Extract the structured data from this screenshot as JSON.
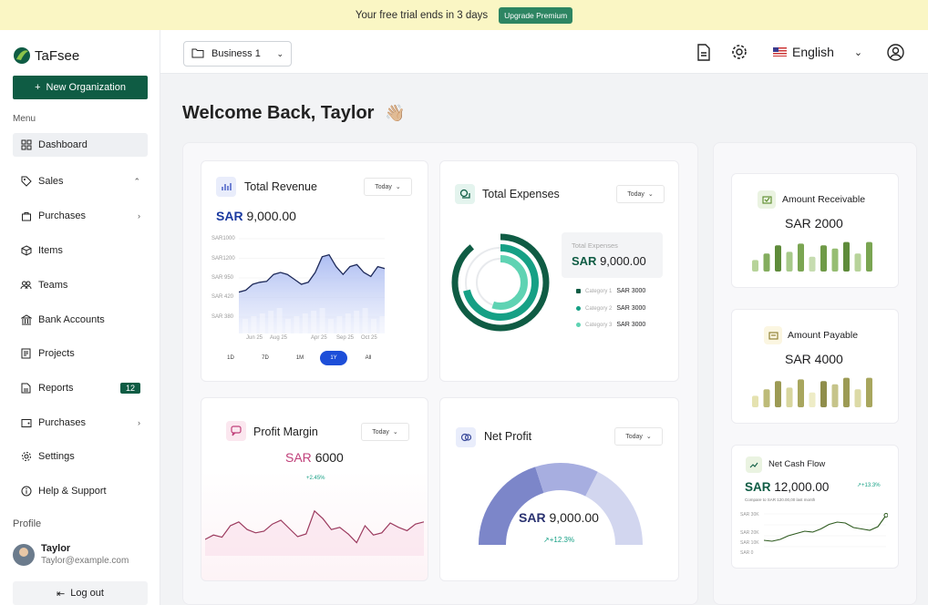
{
  "banner": {
    "text": "Your free trial ends in 3 days",
    "button": "Upgrade Premium"
  },
  "brand": {
    "name": "TaFsee"
  },
  "sidebar": {
    "new_org": "New Organization",
    "menu_label": "Menu",
    "items": [
      {
        "label": "Dashboard",
        "icon": "grid-icon"
      },
      {
        "label": "Sales",
        "icon": "tag-icon"
      },
      {
        "label": "Purchases",
        "icon": "bag-icon"
      },
      {
        "label": "Items",
        "icon": "box-icon"
      },
      {
        "label": "Teams",
        "icon": "users-icon"
      },
      {
        "label": "Bank Accounts",
        "icon": "bank-icon"
      },
      {
        "label": "Projects",
        "icon": "document-icon"
      },
      {
        "label": "Reports",
        "icon": "report-icon",
        "count": "12"
      },
      {
        "label": "Purchases",
        "icon": "wallet-icon"
      },
      {
        "label": "Settings",
        "icon": "gear-icon"
      },
      {
        "label": "Help & Support",
        "icon": "info-icon"
      }
    ],
    "profile_label": "Profile",
    "user": {
      "name": "Taylor",
      "email": "Taylor@example.com"
    },
    "logout": "Log out"
  },
  "topbar": {
    "business": "Business 1",
    "language": "English"
  },
  "welcome": "Welcome Back, Taylor",
  "wave_emoji": "👋🏼",
  "dropdown": "Today",
  "revenue": {
    "title": "Total Revenue",
    "currency": "SAR",
    "amount": "9,000.00",
    "chart_data": {
      "type": "area",
      "y_ticks": [
        "SAR1000",
        "SAR1200",
        "SAR 950",
        "SAR 420",
        "SAR 380"
      ],
      "x_ticks": [
        "Jun 25",
        "Aug 25",
        "Apr 25",
        "Sep 25",
        "Oct 25"
      ],
      "ranges": [
        "1D",
        "7D",
        "1M",
        "1Y",
        "All"
      ],
      "active_range": "1Y",
      "values": [
        0.42,
        0.44,
        0.5,
        0.52,
        0.53,
        0.6,
        0.62,
        0.6,
        0.55,
        0.5,
        0.52,
        0.62,
        0.78,
        0.8,
        0.68,
        0.6,
        0.68,
        0.7,
        0.62,
        0.58,
        0.68,
        0.66
      ]
    }
  },
  "expenses": {
    "title": "Total Expenses",
    "summary_label": "Total Expenses",
    "currency": "SAR",
    "amount": "9,000.00",
    "chart_data": {
      "type": "radial",
      "categories": [
        {
          "name": "Category 1",
          "value": "SAR 3000",
          "color": "#0f5c44"
        },
        {
          "name": "Category 2",
          "value": "SAR 3000",
          "color": "#16a085"
        },
        {
          "name": "Category 3",
          "value": "SAR 3000",
          "color": "#5fd3b3"
        }
      ]
    }
  },
  "profit_margin": {
    "title": "Profit Margin",
    "currency": "SAR",
    "amount": "6000",
    "change": "+2.45%",
    "chart_data": {
      "type": "line",
      "values": [
        0.3,
        0.38,
        0.34,
        0.55,
        0.62,
        0.48,
        0.42,
        0.45,
        0.58,
        0.65,
        0.5,
        0.35,
        0.4,
        0.82,
        0.68,
        0.48,
        0.52,
        0.4,
        0.24,
        0.55,
        0.38,
        0.42,
        0.6,
        0.52,
        0.46,
        0.58,
        0.62
      ]
    }
  },
  "net_profit": {
    "title": "Net Profit",
    "currency": "SAR",
    "amount": "9,000.00",
    "change": "+12.3%",
    "chart_data": {
      "type": "gauge",
      "segments": [
        {
          "value": 0.4,
          "color": "#7c86c9"
        },
        {
          "value": 0.25,
          "color": "#a7aee0"
        },
        {
          "value": 0.35,
          "color": "#d2d6ef"
        }
      ]
    }
  },
  "receivable": {
    "title": "Amount Receivable",
    "value": "SAR 2000",
    "chart_data": {
      "type": "bar",
      "values": [
        0.35,
        0.55,
        0.8,
        0.6,
        0.85,
        0.45,
        0.8,
        0.7,
        0.9,
        0.55,
        0.9
      ]
    }
  },
  "payable": {
    "title": "Amount Payable",
    "value": "SAR 4000",
    "chart_data": {
      "type": "bar",
      "values": [
        0.35,
        0.55,
        0.8,
        0.6,
        0.85,
        0.45,
        0.8,
        0.7,
        0.9,
        0.55,
        0.9
      ]
    }
  },
  "cashflow": {
    "title": "Net Cash Flow",
    "currency": "SAR",
    "amount": "12,000.00",
    "change": "+13.3%",
    "compare": "Compare to SAR 120.00,00 last month",
    "chart_data": {
      "type": "line",
      "y_ticks": [
        "SAR 30K",
        "SAR 20K",
        "SAR 10K",
        "SAR 0"
      ],
      "values": [
        0.3,
        0.28,
        0.32,
        0.4,
        0.45,
        0.5,
        0.48,
        0.55,
        0.65,
        0.7,
        0.68,
        0.58,
        0.55,
        0.52,
        0.6,
        0.85
      ]
    }
  }
}
